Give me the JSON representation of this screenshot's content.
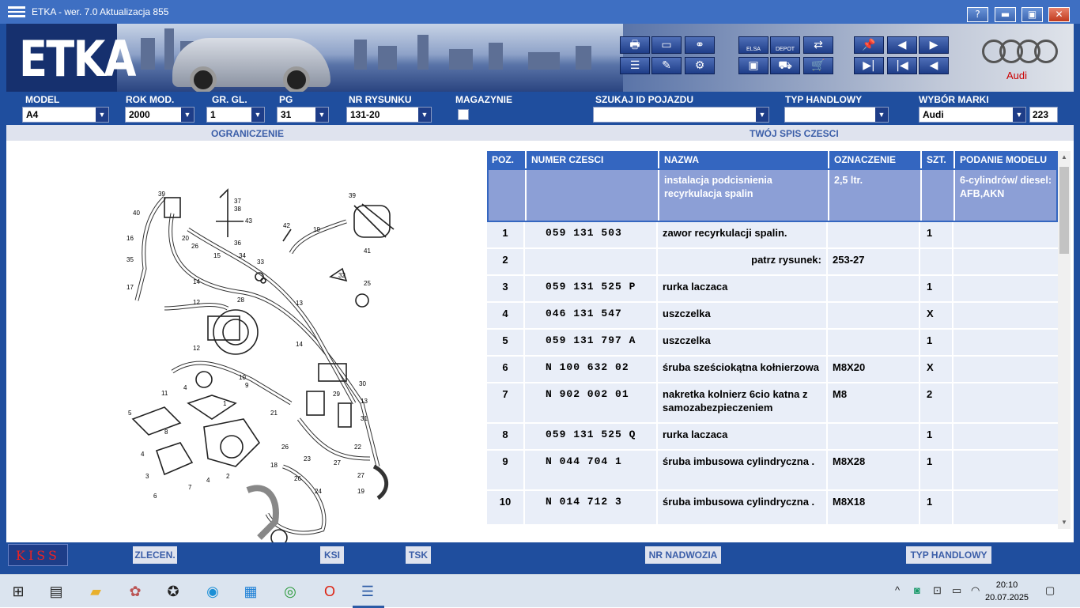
{
  "window": {
    "title": "ETKA - wer. 7.0 Aktualizacja 855"
  },
  "titlebar_buttons": {
    "help": "?",
    "minimize": "▬",
    "maximize": "▣",
    "close": "✕"
  },
  "banner": {
    "logo": "ETKA",
    "brand": "Audi",
    "toolbar_icons": [
      "printer-icon",
      "window-icon",
      "binoculars-icon",
      "list-icon",
      "pencil-icon",
      "network-icon",
      "elsa-icon",
      "depot-icon",
      "cart-transfer-icon",
      "monitor-icon",
      "car-icon",
      "cart-icon",
      "pin-icon",
      "prev-page-icon",
      "next-page-icon",
      "end-icon",
      "first-icon",
      "prev-icon"
    ],
    "elsa_label": "ELSA",
    "depot_label": "DEPOT"
  },
  "filters": {
    "model": {
      "label": "MODEL",
      "value": "A4"
    },
    "rok_mod": {
      "label": "ROK MOD.",
      "value": "2000"
    },
    "gr_gl": {
      "label": "GR. GL.",
      "value": "1"
    },
    "pg": {
      "label": "PG",
      "value": "31"
    },
    "nr_rysunku": {
      "label": "NR RYSUNKU",
      "value": "131-20"
    },
    "magazynie": {
      "label": "MAGAZYNIE"
    },
    "szukaj": {
      "label": "SZUKAJ ID POJAZDU",
      "value": ""
    },
    "typ_handlowy": {
      "label": "TYP HANDLOWY",
      "value": ""
    },
    "wybor_marki": {
      "label": "WYBÓR MARKI",
      "value": "Audi",
      "count": "223"
    }
  },
  "sections": {
    "left": "OGRANICZENIE",
    "right": "TWÓJ SPIS CZESCI"
  },
  "diagram_labels": [
    "39",
    "40",
    "16",
    "35",
    "17",
    "26",
    "20",
    "15",
    "14",
    "12",
    "37",
    "38",
    "43",
    "36",
    "34",
    "33",
    "28",
    "12",
    "11",
    "4",
    "5",
    "8",
    "4",
    "3",
    "6",
    "7",
    "4",
    "2",
    "1",
    "10",
    "9",
    "42",
    "19",
    "39",
    "41",
    "32",
    "25",
    "13",
    "14",
    "13",
    "30",
    "29",
    "21",
    "31",
    "22",
    "27",
    "26",
    "23",
    "18",
    "24",
    "19"
  ],
  "table": {
    "headers": [
      "POZ.",
      "NUMER CZESCI",
      "NAZWA",
      "OZNACZENIE",
      "SZT.",
      "PODANIE MODELU"
    ],
    "header_row": {
      "nazwa": "instalacja podcisnienia recyrkulacja spalin",
      "oznaczenie": "2,5 ltr.",
      "podanie": "6-cylindrów/ diesel: AFB,AKN"
    },
    "rows": [
      {
        "poz": "1",
        "numer": "059 131 503",
        "nazwa": "zawor recyrkulacji spalin.",
        "ozn": "",
        "szt": "1"
      },
      {
        "poz": "2",
        "numer": "",
        "nazwa": "patrz rysunek:",
        "ozn": "253-27",
        "szt": ""
      },
      {
        "poz": "3",
        "numer": "059 131 525 P",
        "nazwa": "rurka laczaca",
        "ozn": "",
        "szt": "1"
      },
      {
        "poz": "4",
        "numer": "046 131 547",
        "nazwa": "uszczelka",
        "ozn": "",
        "szt": "X"
      },
      {
        "poz": "5",
        "numer": "059 131 797 A",
        "nazwa": "uszczelka",
        "ozn": "",
        "szt": "1"
      },
      {
        "poz": "6",
        "numer": "N  100 632 02",
        "nazwa": "śruba sześciokątna kołnierzowa",
        "ozn": "M8X20",
        "szt": "X"
      },
      {
        "poz": "7",
        "numer": "N  902 002 01",
        "nazwa": "nakretka kolnierz 6cio katna z samozabezpieczeniem",
        "ozn": "M8",
        "szt": "2"
      },
      {
        "poz": "8",
        "numer": "059 131 525 Q",
        "nazwa": "rurka laczaca",
        "ozn": "",
        "szt": "1"
      },
      {
        "poz": "9",
        "numer": "N  044 704 1",
        "nazwa": "śruba imbusowa cylindryczna .",
        "ozn": "M8X28",
        "szt": "1"
      },
      {
        "poz": "10",
        "numer": "N  014 712 3",
        "nazwa": "śruba imbusowa cylindryczna .",
        "ozn": "M8X18",
        "szt": "1"
      }
    ]
  },
  "bottombar": {
    "kiss": "KISS",
    "zlecen": "ZLECEN.",
    "ksi": "KSI",
    "tsk": "TSK",
    "nr_nadwozia": "NR NADWOZIA",
    "typ_handlowy": "TYP HANDLOWY"
  },
  "taskbar": {
    "time": "20:10",
    "date": "20.07.2025"
  }
}
